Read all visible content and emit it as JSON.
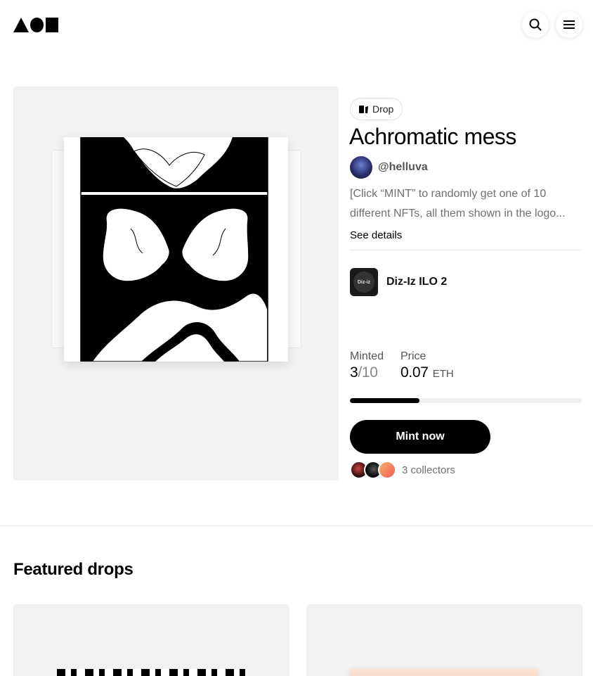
{
  "header": {
    "logo_label": "AOI",
    "search_icon": "search-icon",
    "menu_icon": "hamburger-menu-icon"
  },
  "drop": {
    "type_label": "Drop",
    "title": "Achromatic mess",
    "creator_handle": "@helluva",
    "description": "[Click “MINT” to randomly get one of 10 different NFTs, all them shown in the logo...",
    "see_details_label": "See details",
    "collection": {
      "name": "Diz-Iz ILO 2",
      "thumb_text": "Diz-iz"
    },
    "stats": {
      "minted_label": "Minted",
      "minted_count": "3",
      "minted_total": "/10",
      "minted_fraction": 0.3,
      "price_label": "Price",
      "price_value": "0.07",
      "price_currency": "ETH"
    },
    "mint_button_label": "Mint now",
    "collectors_label": "3 collectors"
  },
  "featured": {
    "title": "Featured drops"
  },
  "colors": {
    "accent": "#000000",
    "media_bg": "#f2f2f2",
    "muted_text": "#707070"
  }
}
